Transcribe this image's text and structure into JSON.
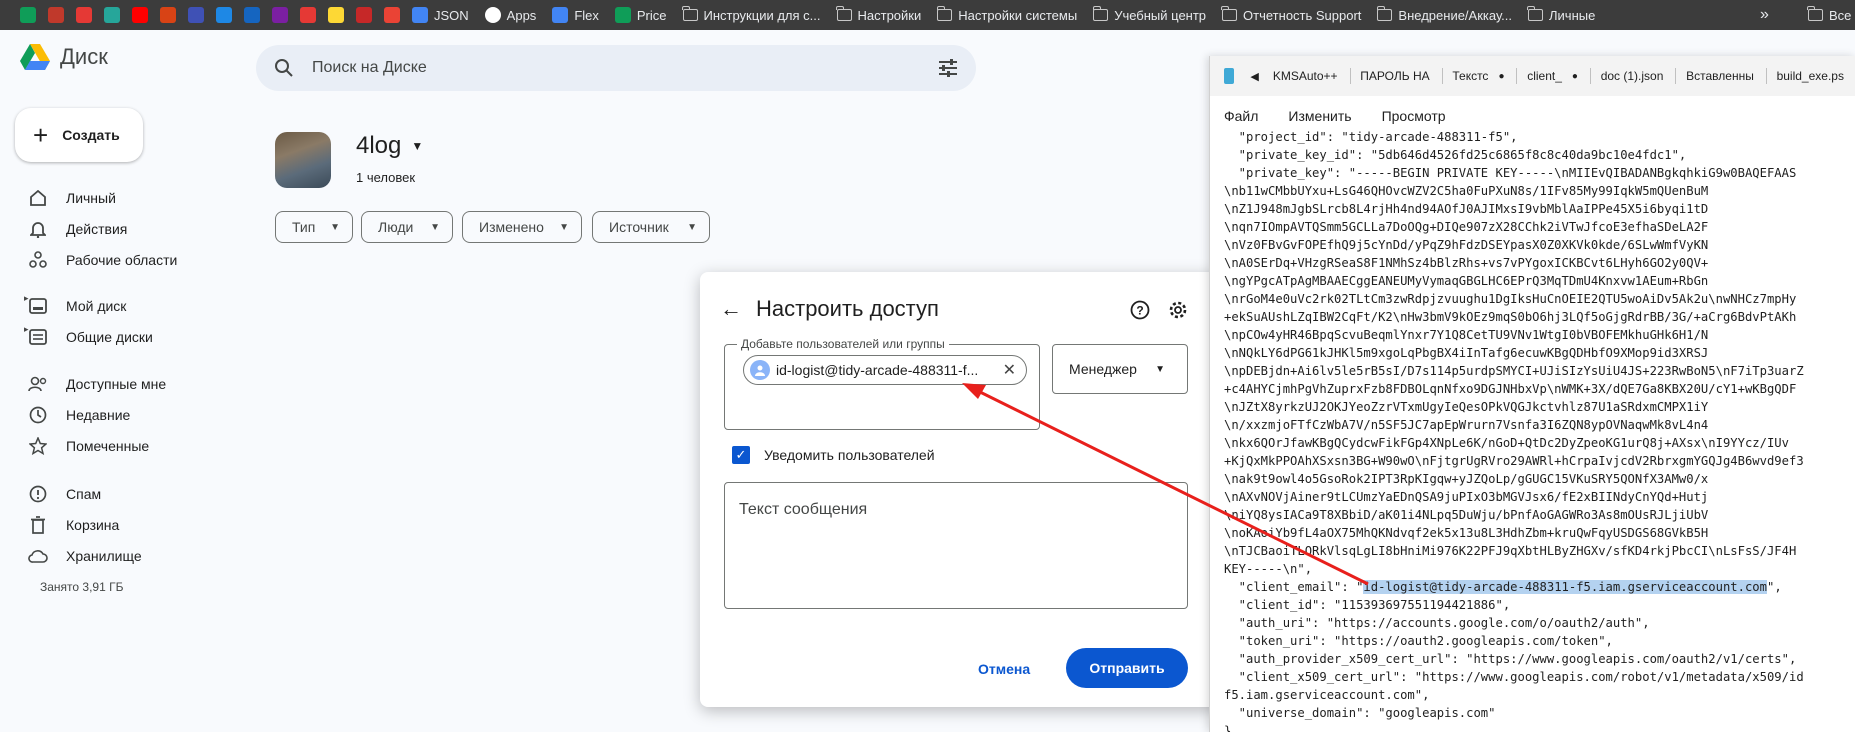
{
  "bookmarks": {
    "items": [
      {
        "label": "JSON",
        "icon": "checkbox-icon",
        "color": "#4285f4"
      },
      {
        "label": "Apps",
        "icon": "google-icon",
        "color": "#ffffff"
      },
      {
        "label": "Flex",
        "icon": "doc-icon",
        "color": "#4285f4"
      },
      {
        "label": "Price",
        "icon": "sheet-icon",
        "color": "#0f9d58"
      }
    ],
    "folders": [
      "Инструкции для с...",
      "Настройки",
      "Настройки системы",
      "Учебный центр",
      "Отчетность Support",
      "Внедрение/Аккау...",
      "Личные"
    ],
    "more": "»",
    "last": "Все"
  },
  "drive": {
    "logo_text": "Диск",
    "search_placeholder": "Поиск на Диске",
    "create_label": "Создать",
    "sidebar": {
      "groups": [
        [
          "Личный",
          "Действия",
          "Рабочие области"
        ],
        [
          "Мой диск",
          "Общие диски"
        ],
        [
          "Доступные мне",
          "Недавние",
          "Помеченные"
        ],
        [
          "Спам",
          "Корзина",
          "Хранилище"
        ]
      ],
      "storage": "Занято 3,91 ГБ"
    },
    "folder": {
      "title": "4log",
      "subtitle": "1 человек"
    },
    "filters": [
      "Тип",
      "Люди",
      "Изменено",
      "Источник"
    ]
  },
  "dialog": {
    "title": "Настроить доступ",
    "add_label": "Добавьте пользователей или группы",
    "user_chip": "id-logist@tidy-arcade-488311-f...",
    "role": "Менеджер",
    "notify_label": "Уведомить пользователей",
    "message_placeholder": "Текст сообщения",
    "cancel": "Отмена",
    "send": "Отправить"
  },
  "notepad": {
    "tabs": [
      "KMSAuto++",
      "ПАРОЛЬ НА",
      "Текстс",
      "client_",
      "doc (1).json",
      "Вставленны",
      "build_exe.ps"
    ],
    "menu": [
      "Файл",
      "Изменить",
      "Просмотр"
    ],
    "lines": [
      "  \"project_id\": \"tidy-arcade-488311-f5\",",
      "  \"private_key_id\": \"5db646d4526fd25c6865f8c8c40da9bc10e4fdc1\",",
      "  \"private_key\": \"-----BEGIN PRIVATE KEY-----\\nMIIEvQIBADANBgkqhkiG9w0BAQEFAAS",
      "\\nb11wCMbbUYxu+LsG46QHOvcWZV2C5ha0FuPXuN8s/1IFv85My99IqkW5mQUenBuM",
      "\\nZ1J948mJgbSLrcb8L4rjHh4nd94AOfJ0AJIMxsI9vbMblAaIPPe45X5i6byqi1tD",
      "\\nqn7IOmpAVTQSmm5GCLLa7DoOQg+DIQe907zX28CChk2iVTwJfcoE3efhaSDeLA2F",
      "\\nVz0FBvGvFOPEfhQ9j5cYnDd/yPqZ9hFdzDSEYpasX0Z0XKVk0kde/6SLwWmfVyKN",
      "\\nA0SErDq+VHzgRSeaS8F1NMhSz4bBlzRhs+vs7vPYgoxICKBCvt6LHyh6GO2y0QV+",
      "\\ngYPgcATpAgMBAAECggEANEUMyVymaqGBGLHC6EPrQ3MqTDmU4Knxvw1AEum+RbGn",
      "\\nrGoM4e0uVc2rk02TLtCm3zwRdpjzvuughu1DgIksHuCnOEIE2QTU5woAiDv5Ak2u\\nwNHCz7mpHy",
      "+ekSuAUshLZqIBW2CqFt/K2\\nHw3bmV9kOEz9mqS0bO6hj3LQf5oGjgRdrBB/3G/+aCrg6BdvPtAKh",
      "\\npCOw4yHR46BpqScvuBeqmlYnxr7Y1Q8CetTU9VNv1WtgI0bVBOFEMkhuGHk6H1/N",
      "\\nNQkLY6dPG61kJHKl5m9xgoLqPbgBX4iInTafg6ecuwKBgQDHbfO9XMop9id3XRSJ",
      "\\npDEBjdn+Ai6lv5le5rB5sI/D7s114p5urdpSMYCI+UJiSIzYsUiU4JS+223RwBoN5\\nF7iTp3uarZ",
      "+c4AHYCjmhPgVhZuprxFzb8FDBOLqnNfxo9DGJNHbxVp\\nWMK+3X/dQE7Ga8KBX20U/cY1+wKBgQDF",
      "\\nJZtX8yrkzUJ2OKJYeoZzrVTxmUgyIeQesOPkVQGJkctvhlz87U1aSRdxmCMPX1iY",
      "\\n/xxzmjoFTfCzWbA7V/n5SF5JC7apEpWrurn7Vsnfa3I6ZQN8ypOVNaqwMk8vL4n4",
      "\\nkx6QOrJfawKBgQCydcwFikFGp4XNpLe6K/nGoD+QtDc2DyZpeoKG1urQ8j+AXsx\\nI9YYcz/IUv",
      "+KjQxMkPPOAhXSxsn3BG+W90wO\\nFjtgrUgRVro29AWRl+hCrpaIvjcdV2RbrxgmYGQJg4B6wvd9ef3",
      "\\nak9t9owl4o5GsoRok2IPT3RpKIgqw+yJZQoLp/gGUGC15VKuSRY5QONfX3AMw0/x",
      "\\nAXvNOVjAiner9tLCUmzYaEDnQSA9juPIxO3bMGVJsx6/fE2xBIINdyCnYQd+Hutj",
      "\\niYQ8ysIACa9T8XBbiD/aK01i4NLpq5DuWju/bPnfAoGAGWRo3As8mOUsRJLjiUbV",
      "\\noKAoiYb9fL4aOX75MhQKNdvqf2ek5x13u8L3HdhZbm+kruQwFqyUSDGS68GVkB5H",
      "\\nTJCBaoiTLQRkVlsqLgLI8bHniMi976K22PFJ9qXbtHLByZHGXv/sfKD4rkjPbcCI\\nLsFsS/JF4H",
      "KEY-----\\n\",",
      "  \"client_email\": \"id-logist@tidy-arcade-488311-f5.iam.gserviceaccount.com\",",
      "  \"client_id\": \"115393697551194421886\",",
      "  \"auth_uri\": \"https://accounts.google.com/o/oauth2/auth\",",
      "  \"token_uri\": \"https://oauth2.googleapis.com/token\",",
      "  \"auth_provider_x509_cert_url\": \"https://www.googleapis.com/oauth2/v1/certs\",",
      "  \"client_x509_cert_url\": \"https://www.googleapis.com/robot/v1/metadata/x509/id",
      "f5.iam.gserviceaccount.com\",",
      "  \"universe_domain\": \"googleapis.com\"",
      "}"
    ],
    "highlight_line": 25,
    "highlight_text": "id-logist@tidy-arcade-488311-f5.iam.gserviceaccount.com"
  },
  "colors": {
    "accent": "#0b57d0",
    "annotation_arrow": "#e8201c"
  }
}
